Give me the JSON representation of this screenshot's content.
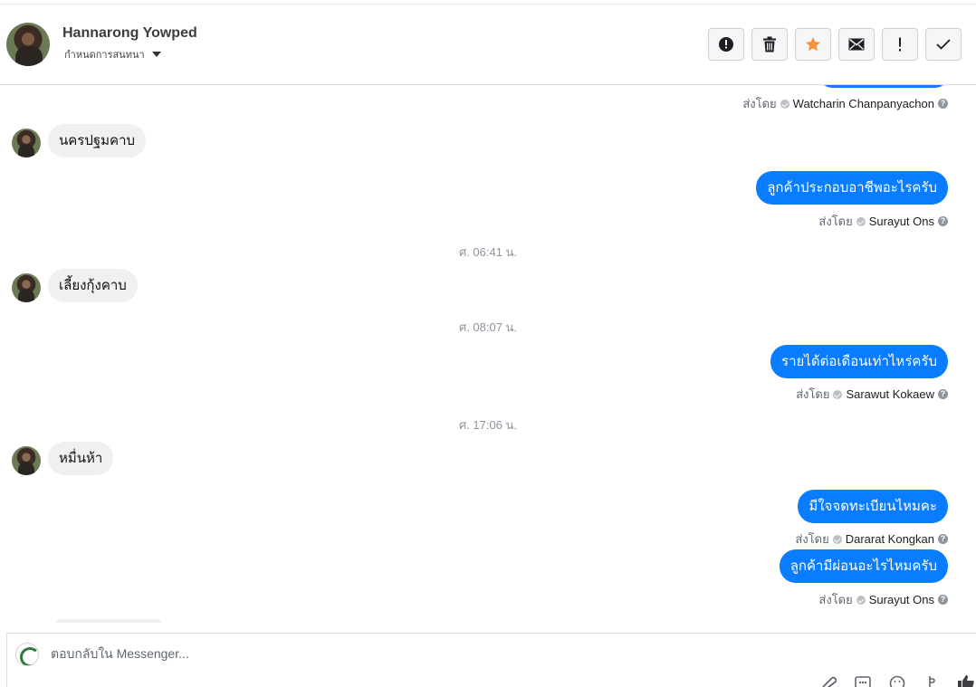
{
  "header": {
    "contact_name": "Hannarong Yowped",
    "assign_label": "กำหนดการสนทนา",
    "actions": [
      {
        "name": "report-spam-button",
        "icon": "exclamation-circle-icon"
      },
      {
        "name": "delete-button",
        "icon": "trash-icon"
      },
      {
        "name": "star-button",
        "icon": "star-icon",
        "color": "#f7923b"
      },
      {
        "name": "mark-unread-button",
        "icon": "envelope-icon"
      },
      {
        "name": "follow-up-button",
        "icon": "exclamation-icon"
      },
      {
        "name": "mark-done-button",
        "icon": "checkmark-icon"
      }
    ]
  },
  "thread": {
    "sent_by_prefix": "ส่งโดย",
    "messages": [
      {
        "sender_label": "Watcharin Chanpanyachon"
      },
      {
        "text": "นครปฐมคาบ"
      },
      {
        "text": "ลูกค้าประกอบอาชีพอะไรครับ",
        "sender_label": "Surayut Ons"
      },
      {
        "time": "ศ. 06:41 น."
      },
      {
        "text": "เลี้ยงกุ้งคาบ"
      },
      {
        "time": "ศ. 08:07 น."
      },
      {
        "text": "รายได้ต่อเดือนเท่าไหร่ครับ",
        "sender_label": "Sarawut Kokaew"
      },
      {
        "time": "ศ. 17:06 น."
      },
      {
        "text": "หมื่นห้า"
      },
      {
        "text": "มีใจจดทะเบียนไหมคะ",
        "sender_label": "Dararat Kongkan"
      },
      {
        "text": "ลูกค้ามีผ่อนอะไรไหมครับ",
        "sender_label": "Surayut Ons"
      }
    ]
  },
  "composer": {
    "placeholder": "ตอบกลับใน Messenger..."
  },
  "colors": {
    "outgoing_bubble": "#0a7cff",
    "incoming_bubble": "#f0f0f0",
    "star": "#f7923b"
  }
}
